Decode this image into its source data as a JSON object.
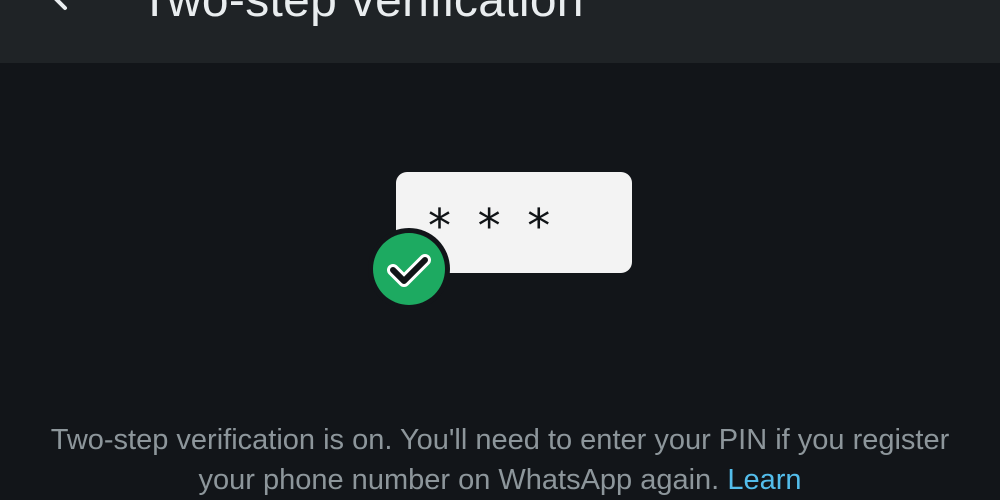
{
  "header": {
    "title": "Two-step verification",
    "back_icon": "back-arrow-icon"
  },
  "illustration": {
    "pin_mask": "* * *",
    "badge_icon": "check-circle-icon",
    "badge_color": "#1daa61",
    "card_color": "#f3f3f3"
  },
  "description": {
    "text": "Two-step verification is on. You'll need to enter your PIN if you register your phone number on WhatsApp again.",
    "link_label": "Learn",
    "link_color": "#53bdeb"
  },
  "colors": {
    "background": "#121519",
    "header_background": "#1f2326",
    "title_text": "#e9edef",
    "body_text": "#8d969b"
  }
}
